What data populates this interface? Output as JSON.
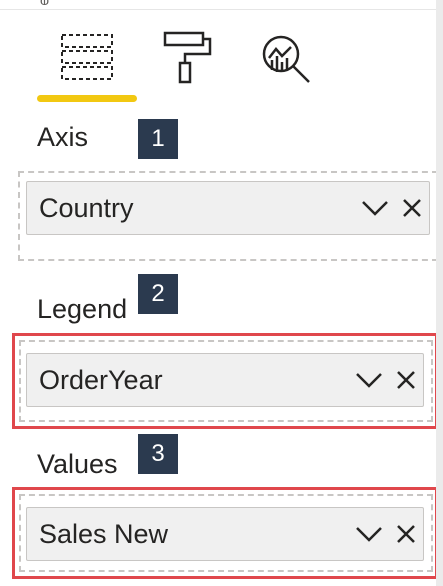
{
  "tabs": [
    {
      "icon": "fields-icon",
      "active": true
    },
    {
      "icon": "format-paint-roller-icon",
      "active": false
    },
    {
      "icon": "analytics-magnifier-icon",
      "active": false
    }
  ],
  "sections": {
    "axis": {
      "label": "Axis",
      "badge": "1",
      "field": "Country"
    },
    "legend": {
      "label": "Legend",
      "badge": "2",
      "field": "OrderYear"
    },
    "values": {
      "label": "Values",
      "badge": "3",
      "field": "Sales New"
    }
  },
  "top_glyph": "ⱷ",
  "colors": {
    "accent_underline": "#f2c811",
    "badge_bg": "#2b3a4f",
    "highlight_border": "#e0474c",
    "pill_bg": "#f0f0f0",
    "well_border": "#c8c6c4"
  }
}
